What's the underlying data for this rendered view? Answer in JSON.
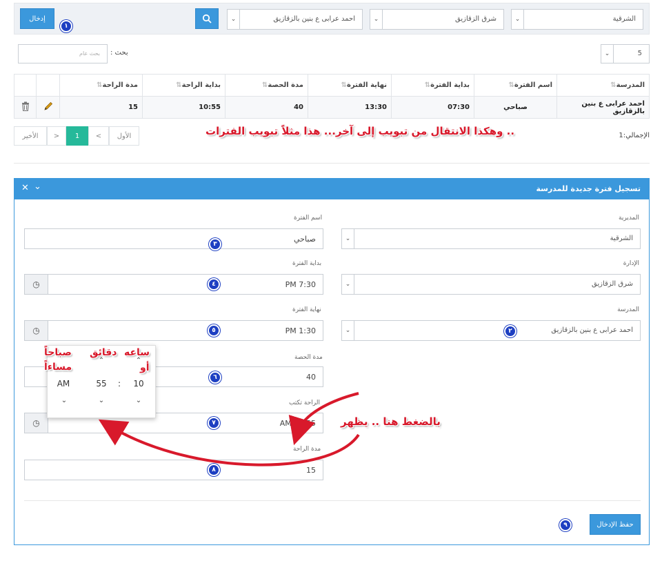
{
  "filters": {
    "directorate": "الشرقية",
    "administration": "شرق الزقازيق",
    "school": "احمد عرابى ع بنين بالزقازيق",
    "search_icon": "search-icon",
    "add_button": "إدخال"
  },
  "toolbar": {
    "page_size": "5",
    "search_label": "بحث :",
    "search_placeholder": "بحث عام"
  },
  "table": {
    "headers": [
      "المدرسة",
      "اسم الفترة",
      "بداية الفترة",
      "نهاية الفترة",
      "مدة الحصة",
      "بداية الراحة",
      "مدة الراحة"
    ],
    "row": [
      "احمد عرابى ع بنين بالزقازيق",
      "صباحي",
      "07:30",
      "13:30",
      "40",
      "10:55",
      "15"
    ],
    "edit_icon": "pencil-icon",
    "delete_icon": "trash-icon"
  },
  "pagination": {
    "total": "الإجمالي:1",
    "first": "الأول",
    "prev": "<",
    "current": "1",
    "next": ">",
    "last": "الأخير"
  },
  "notes": {
    "tabs_note": ".. وهكذا الانتقال من تبويب إلى آخر... هذا مثلاً تبويب الفترات",
    "click_note": "بالضغط هنا .. يظهر",
    "hour_note_1": "ساعه",
    "hour_note_2": "أو",
    "minutes_note": "دقائق",
    "ampm_note_1": "صباحاً",
    "ampm_note_2": "مساءاً"
  },
  "form": {
    "title": "تسجيل فترة جديدة للمدرسة",
    "directorate_label": "المديرية",
    "directorate_value": "الشرقية",
    "administration_label": "الإدارة",
    "administration_value": "شرق الزقازيق",
    "school_label": "المدرسة",
    "school_value": "احمد عرابى ع بنين بالزقازيق",
    "period_name_label": "اسم الفترة",
    "period_name_value": "صباحي",
    "period_start_label": "بداية الفترة",
    "period_start_value": "PM 7:30",
    "period_end_label": "نهاية الفترة",
    "period_end_value": "PM 1:30",
    "lesson_duration_label": "مدة الحصة",
    "lesson_duration_value": "40",
    "break_start_label": "الراحة تكتب",
    "break_start_value": "AM 10:55",
    "break_duration_label": "مدة الراحة",
    "break_duration_value": "15",
    "save_button": "حفظ الإدخال"
  },
  "time_picker": {
    "hour": "10",
    "separator": ":",
    "minute": "55",
    "meridiem": "AM"
  },
  "step_badges": [
    "١",
    "٢",
    "٣",
    "٤",
    "٥",
    "٦",
    "٧",
    "٨",
    "٩"
  ],
  "colors": {
    "accent": "#3b98dc",
    "badge": "#1d3fc2",
    "annotation": "#d8192b",
    "pager_active": "#26b99a"
  }
}
